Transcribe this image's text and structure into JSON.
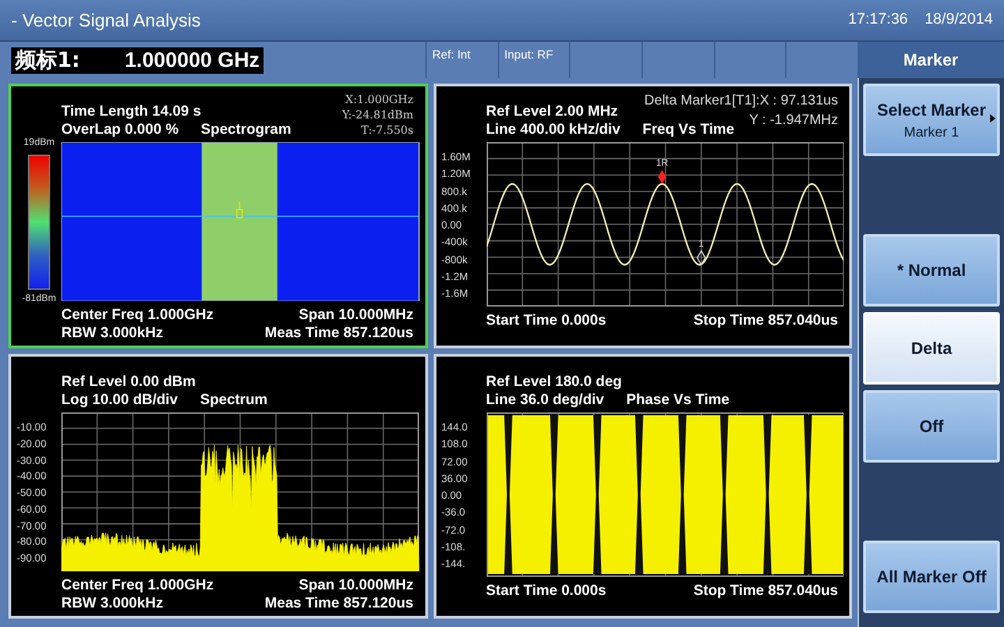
{
  "window": {
    "title": "- Vector Signal Analysis",
    "time": "17:17:36",
    "date": "18/9/2014"
  },
  "marker_readout": {
    "label": "频标1:",
    "value": "1.000000 GHz"
  },
  "status": [
    "Ref: Int",
    "Input: RF"
  ],
  "panels": [
    {
      "kind": "spectrogram",
      "selected": true,
      "title": "Spectrogram",
      "header": [
        "Time Length 14.09 s",
        "OverLap 0.000 %"
      ],
      "readout": [
        "X:1.000GHz",
        "Y:-24.81dBm",
        "T:-7.550s"
      ],
      "scale": [
        "19dBm",
        "-81dBm"
      ],
      "footer_left": [
        "Center Freq 1.000GHz",
        "RBW 3.000kHz"
      ],
      "footer_right": [
        "Span 10.000MHz",
        "Meas Time 857.120us"
      ]
    },
    {
      "kind": "sine",
      "selected": false,
      "title": "Freq Vs Time",
      "header": [
        "Ref Level 2.00 MHz",
        "Line 400.00 kHz/div"
      ],
      "readout": [
        "Delta Marker1[T1]:X : 97.131us",
        "Y : -1.947MHz"
      ],
      "y_labels": [
        "1.60M",
        "1.20M",
        "800.k",
        "400.k",
        "0.00",
        "-400k",
        "-800k",
        "-1.2M",
        "-1.6M"
      ],
      "markers": [
        "1R",
        "1"
      ],
      "footer_left": [
        "Start Time 0.000s"
      ],
      "footer_right": [
        "Stop Time 857.040us"
      ]
    },
    {
      "kind": "spectrum",
      "selected": false,
      "title": "Spectrum",
      "header": [
        "Ref Level 0.00 dBm",
        "Log 10.00 dB/div"
      ],
      "y_labels": [
        "-10.00",
        "-20.00",
        "-30.00",
        "-40.00",
        "-50.00",
        "-60.00",
        "-70.00",
        "-80.00",
        "-90.00"
      ],
      "footer_left": [
        "Center Freq 1.000GHz",
        "RBW 3.000kHz"
      ],
      "footer_right": [
        "Span 10.000MHz",
        "Meas Time 857.120us"
      ]
    },
    {
      "kind": "phase",
      "selected": false,
      "title": "Phase Vs Time",
      "header": [
        "Ref Level 180.0 deg",
        "Line 36.0 deg/div"
      ],
      "y_labels": [
        "144.0",
        "108.0",
        "72.00",
        "36.00",
        "0.00",
        "-36.0",
        "-72.0",
        "-108.",
        "-144."
      ],
      "footer_left": [
        "Start Time 0.000s"
      ],
      "footer_right": [
        "Stop Time 857.040us"
      ]
    }
  ],
  "softkey_menu": {
    "title": "Marker",
    "keys": [
      {
        "kind": "button",
        "label": "Select Marker",
        "sub": "Marker 1",
        "submenu": true,
        "selected": false
      },
      {
        "kind": "blank"
      },
      {
        "kind": "button",
        "label": "* Normal",
        "selected": false
      },
      {
        "kind": "button",
        "label": "Delta",
        "selected": true
      },
      {
        "kind": "button",
        "label": "Off",
        "selected": false
      },
      {
        "kind": "blank"
      },
      {
        "kind": "button",
        "label": "All Marker Off",
        "selected": false
      }
    ]
  }
}
